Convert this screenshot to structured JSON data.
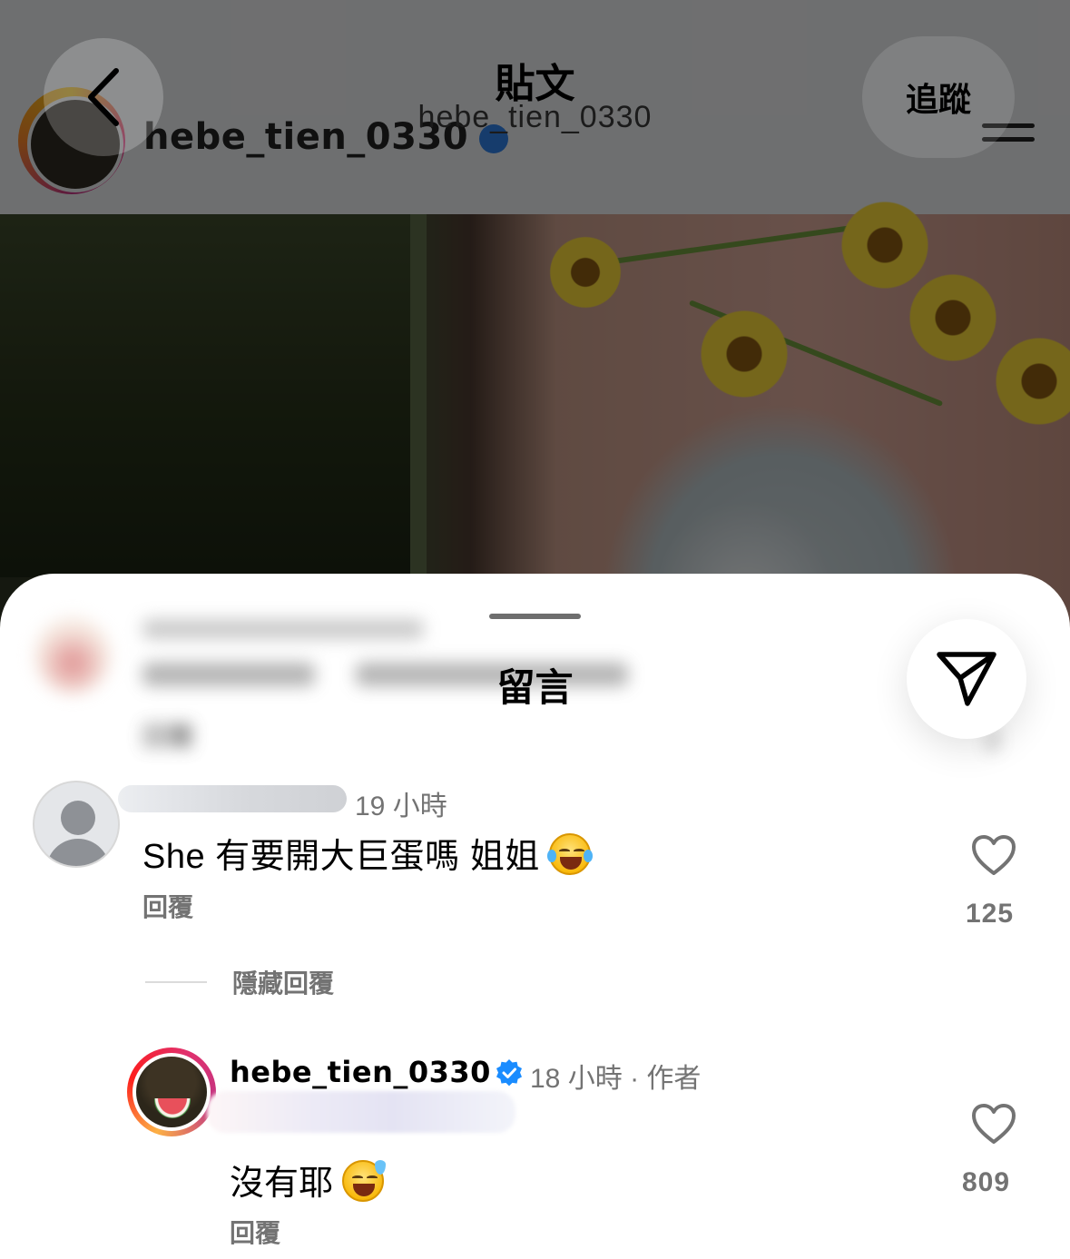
{
  "header": {
    "title": "貼文",
    "subtitle": "hebe_tien_0330",
    "follow_label": "追蹤"
  },
  "background_post": {
    "username": "hebe_tien_0330"
  },
  "comments_sheet": {
    "title": "留言",
    "blurred_comment": {
      "reply_label": "回覆",
      "likes": "2"
    },
    "comments": [
      {
        "time": "19 小時",
        "text": "She 有要開大巨蛋嗎 姐姐",
        "emoji": "face-with-tears-of-joy",
        "reply_label": "回覆",
        "likes": "125"
      },
      {
        "username": "hebe_tien_0330",
        "verified": true,
        "time": "18 小時",
        "separator": "·",
        "author_label": "作者",
        "text": "沒有耶",
        "emoji": "grinning-face-with-sweat",
        "reply_label": "回覆",
        "likes": "809"
      }
    ],
    "hide_replies_label": "隱藏回覆"
  },
  "colors": {
    "secondary_text": "#737373",
    "verified_blue": "#1a8cff",
    "sheet_bg": "#ffffff"
  },
  "icons": {
    "back": "chevron-left-icon",
    "share": "send-icon",
    "like": "heart-outline-icon",
    "verified": "verified-badge-icon",
    "menu": "menu-icon"
  }
}
